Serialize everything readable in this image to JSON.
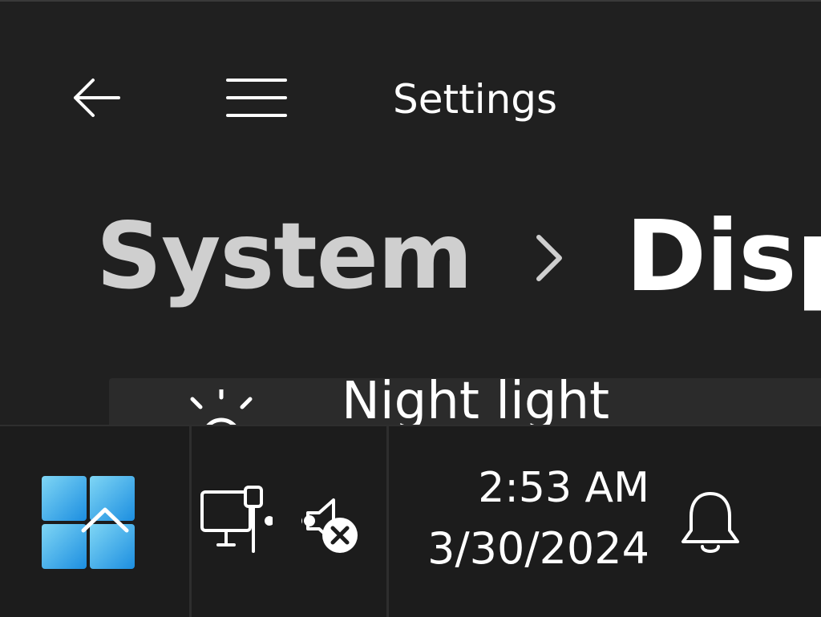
{
  "app": {
    "title": "Settings",
    "back_icon": "arrow-left-icon",
    "menu_icon": "hamburger-menu-icon"
  },
  "breadcrumb": {
    "parent": "System",
    "separator_icon": "chevron-right-icon",
    "current": "Disp"
  },
  "settings": {
    "night_light": {
      "label": "Night light",
      "icon": "brightness-icon"
    }
  },
  "taskbar": {
    "start_icon": "windows-start-icon",
    "network_icon": "wired-network-icon",
    "volume_icon": "volume-muted-icon",
    "time": "2:53 AM",
    "date": "3/30/2024",
    "notification_icon": "bell-icon"
  },
  "colors": {
    "background": "#202020",
    "taskbar": "#1c1c1c",
    "card": "#2b2b2b",
    "accent": "#0078d4"
  }
}
